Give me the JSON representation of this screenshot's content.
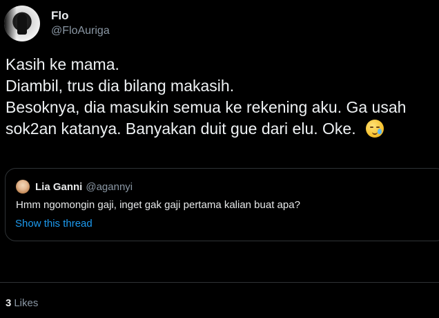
{
  "author": {
    "display_name": "Flo",
    "handle": "@FloAuriga"
  },
  "tweet": {
    "lines": [
      "Kasih ke mama.",
      "Diambil, trus dia bilang makasih.",
      "Besoknya, dia masukin semua ke rekening aku. Ga usah",
      "sok2an katanya. Banyakan duit gue dari elu. Oke."
    ],
    "emoji": "face-holding-back-tears"
  },
  "quoted_tweet": {
    "display_name": "Lia Ganni",
    "handle": "@agannyi",
    "text": "Hmm ngomongin gaji, inget gak gaji pertama kalian buat apa?",
    "show_thread_label": "Show this thread"
  },
  "stats": {
    "likes_count": "3",
    "likes_label": "Likes"
  },
  "colors": {
    "background": "#000000",
    "primary_text": "#e7e9ea",
    "secondary_text": "#8b98a5",
    "link": "#1d9bf0",
    "border": "#2f3336"
  }
}
